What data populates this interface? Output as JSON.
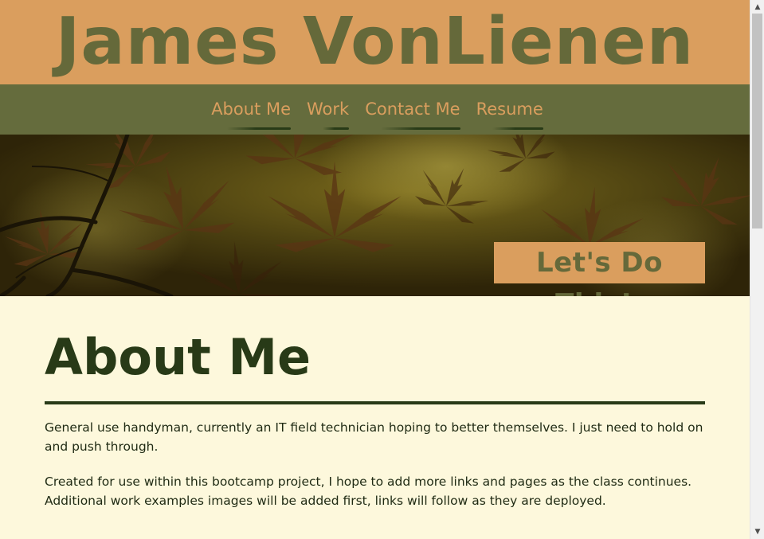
{
  "header": {
    "title": "James VonLienen"
  },
  "nav": {
    "items": [
      {
        "label": "About Me"
      },
      {
        "label": "Work"
      },
      {
        "label": "Contact Me"
      },
      {
        "label": "Resume"
      }
    ]
  },
  "hero": {
    "badge_text": "Let's Do This!."
  },
  "about": {
    "heading": "About Me",
    "paragraphs": [
      "General use handyman, currently an IT field technician hoping to better themselves. I just need to hold on and push through.",
      "Created for use within this bootcamp project, I hope to add more links and pages as the class continues. Additional work examples images will be added first, links will follow as they are deployed."
    ]
  },
  "colors": {
    "header_bg": "#da9e5e",
    "title_text": "#65693a",
    "nav_bg": "#656c3d",
    "nav_text": "#da9e5e",
    "content_bg": "#fdf8dc",
    "heading_text": "#283a17"
  },
  "scrollbar": {
    "up_icon": "triangle-up-icon",
    "down_icon": "triangle-down-icon"
  }
}
